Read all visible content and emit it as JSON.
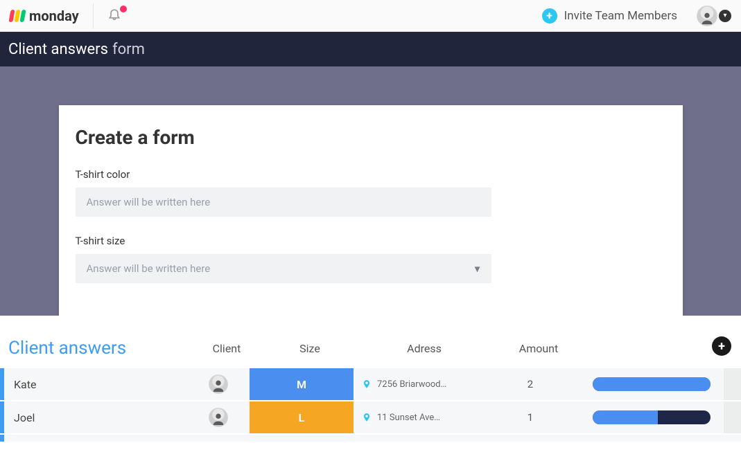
{
  "header": {
    "brand": "monday",
    "invite_label": "Invite Team Members"
  },
  "titlebar": {
    "main": "Client answers",
    "suffix": "form"
  },
  "form": {
    "heading": "Create a form",
    "fields": [
      {
        "label": "T-shirt color",
        "placeholder": "Answer will be written here",
        "type": "text"
      },
      {
        "label": "T-shirt size",
        "placeholder": "Answer will be written here",
        "type": "select"
      }
    ]
  },
  "board": {
    "title": "Client answers",
    "columns": {
      "client": "Client",
      "size": "Size",
      "address": "Adress",
      "amount": "Amount"
    },
    "rows": [
      {
        "name": "Kate",
        "size": "M",
        "size_color": "#4a8ef0",
        "address": "7256 Briarwood…",
        "amount": "2",
        "bar_pct": 100
      },
      {
        "name": "Joel",
        "size": "L",
        "size_color": "#f5a623",
        "address": "11 Sunset Ave…",
        "amount": "1",
        "bar_pct": 55
      }
    ]
  },
  "colors": {
    "accent_blue": "#3e9cf4",
    "bar_track": "#1f2748",
    "bar_fill": "#4a8ef0"
  }
}
